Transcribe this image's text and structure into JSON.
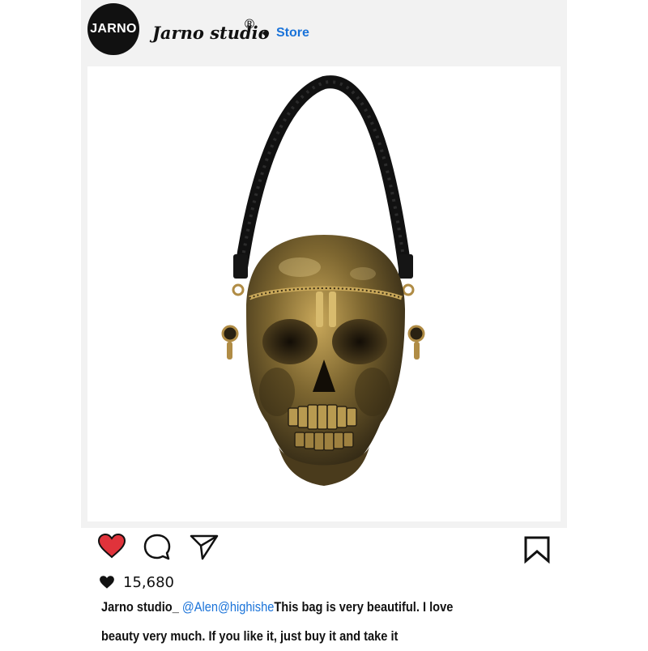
{
  "header": {
    "avatar_text": "JARNO",
    "account_name": "Jarno studio",
    "registered_mark": "®",
    "store_link": "Store"
  },
  "post": {
    "image_icon": "skull-handbag-photo",
    "like_count": "15,680",
    "caption": {
      "author": "Jarno studio_",
      "mentions": "@Alen@highishe",
      "text": "This bag is very beautiful. I love beauty very much. If you like it, just buy it and take it"
    }
  },
  "actions": {
    "like_icon": "heart-icon",
    "comment_icon": "comment-icon",
    "share_icon": "send-icon",
    "save_icon": "bookmark-icon"
  },
  "colors": {
    "like_red": "#e0333b",
    "link_blue": "#1a73d9",
    "card_bg": "#f2f2f2"
  }
}
